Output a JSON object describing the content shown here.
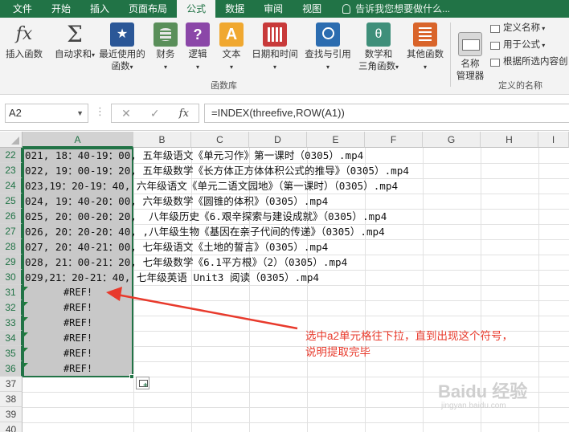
{
  "ribbon_tabs": [
    "文件",
    "开始",
    "插入",
    "页面布局",
    "公式",
    "数据",
    "审阅",
    "视图"
  ],
  "active_tab": "公式",
  "tell_me": "告诉我您想要做什么...",
  "ribbon": {
    "buttons": [
      {
        "label": "插入函数",
        "icon": "fx-icon"
      },
      {
        "label": "自动求和",
        "icon": "sigma-icon",
        "dropdown": true
      },
      {
        "label": "最近使用的",
        "label2": "函数",
        "icon": "star-icon",
        "dropdown": true
      },
      {
        "label": "财务",
        "icon": "finance-icon",
        "dropdown": true
      },
      {
        "label": "逻辑",
        "icon": "logic-icon",
        "dropdown": true
      },
      {
        "label": "文本",
        "icon": "text-icon",
        "dropdown": true
      },
      {
        "label": "日期和时间",
        "icon": "calendar-icon",
        "dropdown": true
      },
      {
        "label": "查找与引用",
        "icon": "lookup-icon",
        "dropdown": true
      },
      {
        "label": "数学和",
        "label2": "三角函数",
        "icon": "math-icon",
        "dropdown": true
      },
      {
        "label": "其他函数",
        "icon": "more-functions-icon",
        "dropdown": true
      },
      {
        "label": "名称",
        "label2": "管理器",
        "icon": "name-manager-icon"
      }
    ],
    "small_buttons": [
      "定义名称",
      "用于公式",
      "根据所选内容创"
    ],
    "group_library": "函数库",
    "group_names": "定义的名称"
  },
  "formula_bar": {
    "name_box": "A2",
    "formula": "=INDEX(threefive,ROW(A1))"
  },
  "columns": [
    "A",
    "B",
    "C",
    "D",
    "E",
    "F",
    "G",
    "H",
    "I"
  ],
  "rows": [
    {
      "num": "22",
      "text": "021, 18：40-19：00, 五年级语文《单元习作》第一课时（0305）.mp4"
    },
    {
      "num": "23",
      "text": "022, 19：00-19：20, 五年级数学《长方体正方体体积公式的推导》（0305）.mp4"
    },
    {
      "num": "24",
      "text": "023,19：20-19：40, 六年级语文《单元二语文园地》（第一课时）（0305）.mp4"
    },
    {
      "num": "25",
      "text": "024, 19：40-20：00, 六年级数学《圆锥的体积》（0305）.mp4"
    },
    {
      "num": "26",
      "text": "025, 20：00-20：20,  八年级历史《6.艰辛探索与建设成就》（0305）.mp4"
    },
    {
      "num": "27",
      "text": "026, 20：20-20：40, ,八年级生物《基因在亲子代间的传递》（0305）.mp4"
    },
    {
      "num": "28",
      "text": "027, 20：40-21：00, 七年级语文《土地的誓言》（0305）.mp4"
    },
    {
      "num": "29",
      "text": "028, 21：00-21：20, 七年级数学《6.1平方根》（2）（0305）.mp4"
    },
    {
      "num": "30",
      "text": "029,21：20-21：40, 七年级英语 Unit3 阅读（0305）.mp4"
    },
    {
      "num": "31",
      "text": "#REF!"
    },
    {
      "num": "32",
      "text": "#REF!"
    },
    {
      "num": "33",
      "text": "#REF!"
    },
    {
      "num": "34",
      "text": "#REF!"
    },
    {
      "num": "35",
      "text": "#REF!"
    },
    {
      "num": "36",
      "text": "#REF!"
    },
    {
      "num": "37",
      "text": ""
    },
    {
      "num": "38",
      "text": ""
    },
    {
      "num": "39",
      "text": ""
    },
    {
      "num": "40",
      "text": ""
    }
  ],
  "annotation": {
    "line1": "选中a2单元格往下拉，直到出现这个符号，",
    "line2": "说明提取完毕",
    "color": "#e83a2c"
  },
  "watermark": {
    "text": "Baidu 经验",
    "sub": "jingyan.baidu.com"
  },
  "accent_color": "#217346"
}
